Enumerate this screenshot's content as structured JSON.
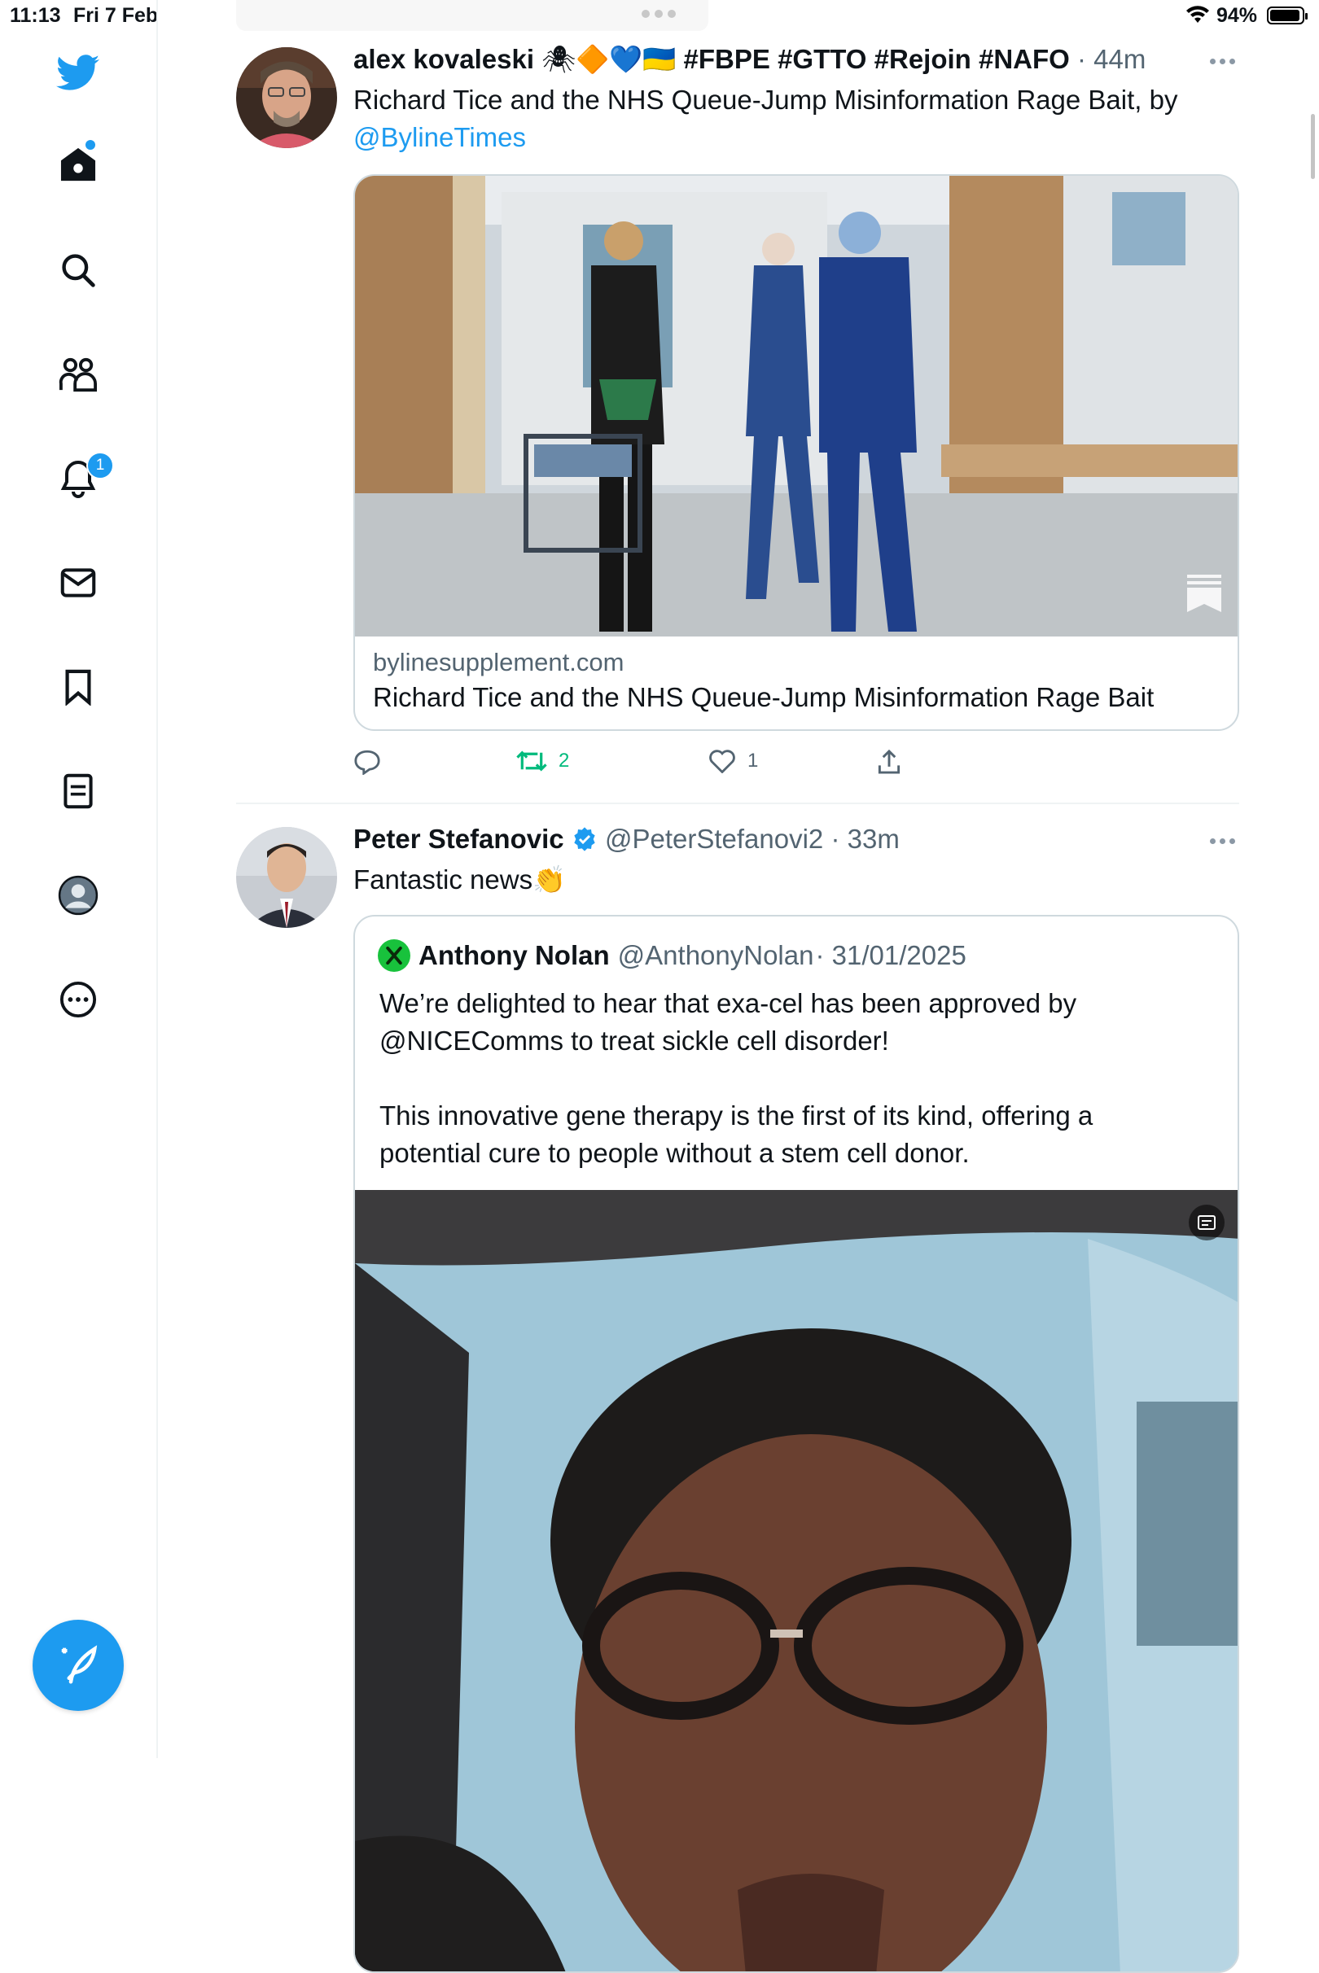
{
  "status_bar": {
    "time": "11:13",
    "date": "Fri 7 Feb",
    "battery": "94%"
  },
  "sidebar": {
    "items": [
      {
        "icon": "twitter-logo-icon"
      },
      {
        "icon": "home-icon"
      },
      {
        "icon": "search-icon"
      },
      {
        "icon": "communities-icon"
      },
      {
        "icon": "notifications-icon",
        "badge": "1"
      },
      {
        "icon": "messages-icon"
      },
      {
        "icon": "bookmarks-icon"
      },
      {
        "icon": "lists-icon"
      },
      {
        "icon": "profile-icon"
      },
      {
        "icon": "more-icon"
      }
    ],
    "compose_icon": "compose-tweet-icon",
    "accent": "#1d9bf0"
  },
  "tweets": [
    {
      "name": "alex kovaleski",
      "name_emojis": "🕷🔶💙🇺🇦",
      "hashtags": "#FBPE #GTTO #Rejoin #NAFO",
      "time": "· 44m",
      "text": "Richard Tice and the NHS Queue-Jump Misinformation Rage Bait, by",
      "link": "@BylineTimes",
      "card": {
        "domain": "bylinesupplement.com",
        "title": "Richard Tice and the NHS Queue-Jump Misinformation Rage Bait"
      },
      "actions": {
        "reply": "",
        "retweets": "2",
        "likes": "1",
        "share": ""
      }
    },
    {
      "name": "Peter Stefanovic",
      "handle": "@PeterStefanovi2",
      "time": "· 33m",
      "verified": true,
      "text": "Fantastic news",
      "text_emoji": "👏",
      "quote": {
        "name": "Anthony Nolan",
        "handle": "@AnthonyNolan",
        "date": "· 31/01/2025",
        "line1": "We’re delighted to hear that exa-cel has been approved by",
        "line2": "@NICEComms to treat sickle cell disorder!",
        "line3": "This innovative gene therapy is the first of its kind, offering a",
        "line4": "potential cure to people without a stem cell donor."
      }
    }
  ]
}
